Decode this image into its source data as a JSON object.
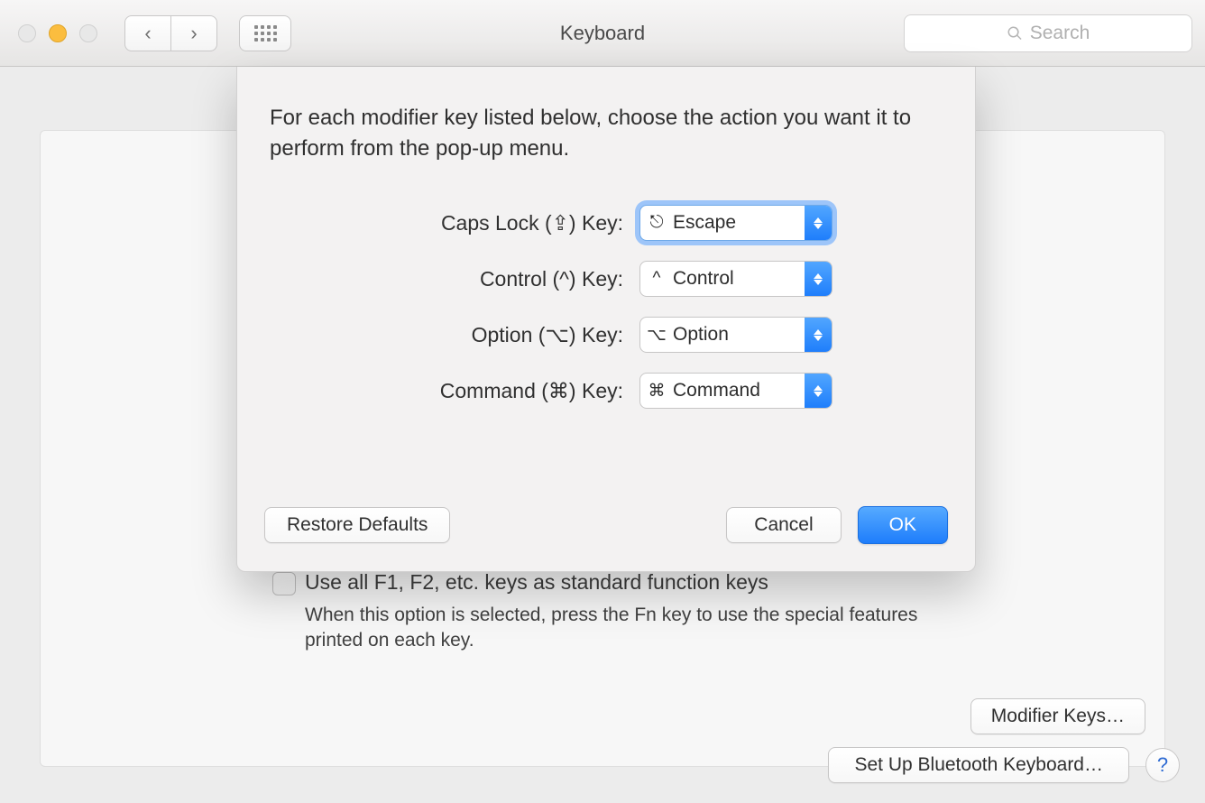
{
  "window": {
    "title": "Keyboard"
  },
  "toolbar": {
    "search_placeholder": "Search"
  },
  "sheet": {
    "description": "For each modifier key listed below, choose the action you want it to perform from the pop-up menu.",
    "rows": [
      {
        "label": "Caps Lock (⇪) Key:",
        "glyph": "⎋",
        "value": "Escape",
        "focused": true
      },
      {
        "label": "Control (^) Key:",
        "glyph": "^",
        "value": "Control",
        "focused": false
      },
      {
        "label": "Option (⌥) Key:",
        "glyph": "⌥",
        "value": "Option",
        "focused": false
      },
      {
        "label": "Command (⌘) Key:",
        "glyph": "⌘",
        "value": "Command",
        "focused": false
      }
    ],
    "buttons": {
      "restore": "Restore Defaults",
      "cancel": "Cancel",
      "ok": "OK"
    }
  },
  "fn": {
    "label": "Use all F1, F2, etc. keys as standard function keys",
    "desc": "When this option is selected, press the Fn key to use the special features printed on each key."
  },
  "buttons": {
    "modifier_keys": "Modifier Keys…",
    "bluetooth": "Set Up Bluetooth Keyboard…"
  },
  "help_glyph": "?"
}
